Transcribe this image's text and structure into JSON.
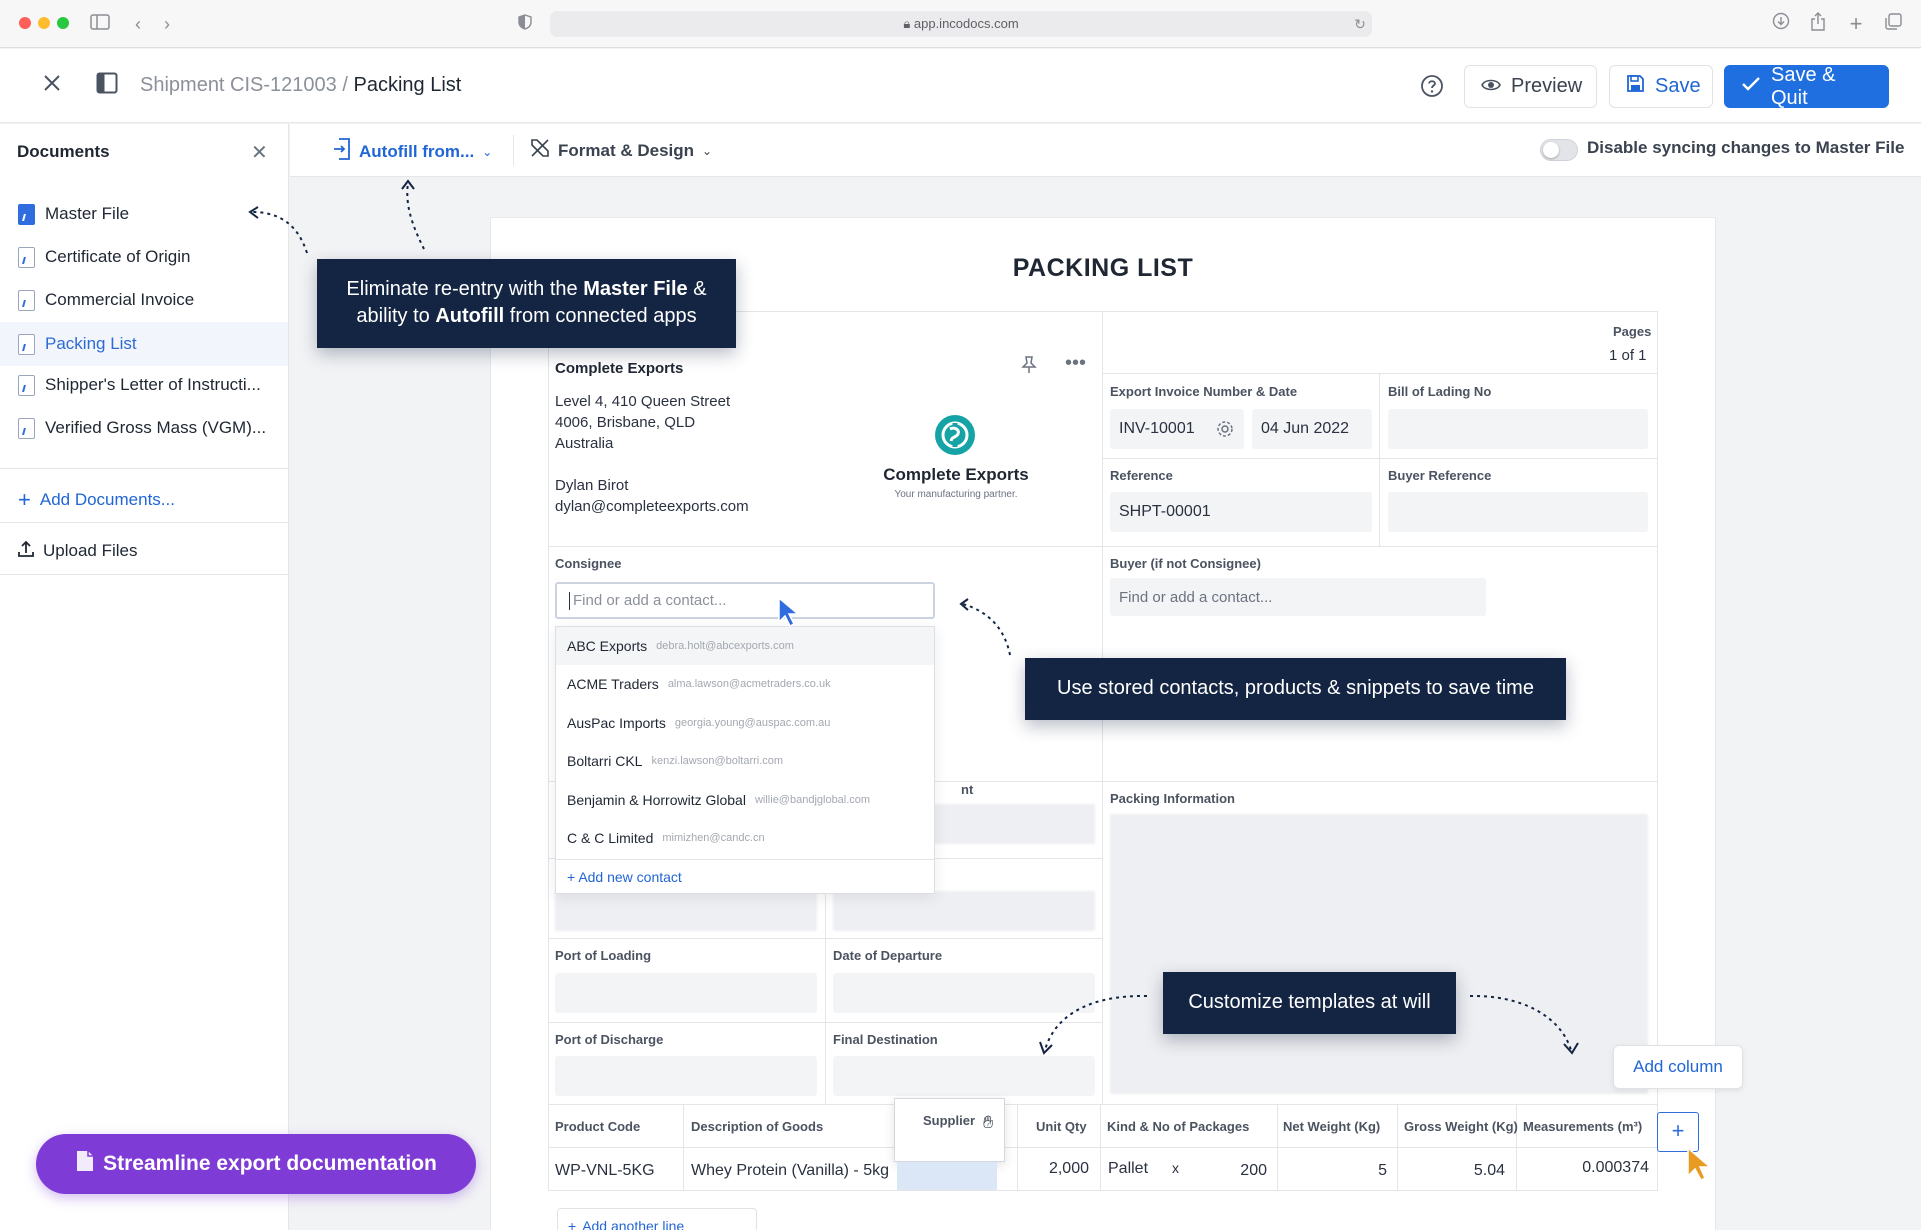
{
  "browser": {
    "url": "app.incodocs.com",
    "dot_colors": [
      "#fe5f57",
      "#febc2e",
      "#28c840"
    ]
  },
  "header": {
    "breadcrumb_parent": "Shipment CIS-121003",
    "breadcrumb_sep": "/",
    "breadcrumb_current": "Packing List",
    "preview_label": "Preview",
    "save_label": "Save",
    "save_quit_label": "Save & Quit"
  },
  "sidebar": {
    "title": "Documents",
    "items": [
      {
        "label": "Master File"
      },
      {
        "label": "Certificate of Origin"
      },
      {
        "label": "Commercial Invoice"
      },
      {
        "label": "Packing List"
      },
      {
        "label": "Shipper's Letter of Instructi..."
      },
      {
        "label": "Verified Gross Mass (VGM)..."
      }
    ],
    "add_documents": "Add Documents...",
    "upload_files": "Upload Files"
  },
  "toolbar": {
    "autofill_label": "Autofill from...",
    "format_label": "Format & Design",
    "sync_toggle_label": "Disable syncing changes to Master File"
  },
  "doc": {
    "title": "PACKING LIST",
    "pages_label": "Pages",
    "pages_value": "1 of 1",
    "exporter_name": "Complete Exports",
    "address_1": "Level 4, 410 Queen Street",
    "address_2": "4006, Brisbane, QLD",
    "address_3": "Australia",
    "contact_name": "Dylan Birot",
    "contact_email": "dylan@completeexports.com",
    "logo_name": "Complete Exports",
    "logo_tagline": "Your manufacturing partner.",
    "invoice_label": "Export Invoice Number & Date",
    "invoice_number": "INV-10001",
    "invoice_date": "04 Jun 2022",
    "bol_label": "Bill of Lading No",
    "reference_label": "Reference",
    "reference_value": "SHPT-00001",
    "buyer_ref_label": "Buyer Reference",
    "consignee_label": "Consignee",
    "consignee_placeholder": "Find or add a contact...",
    "buyer_label": "Buyer (if not Consignee)",
    "buyer_placeholder": "Find or add a contact...",
    "packing_info_label": "Packing Information",
    "port_loading_label": "Port of Loading",
    "date_departure_label": "Date of Departure",
    "port_discharge_label": "Port of Discharge",
    "final_destination_label": "Final Destination",
    "partial_label_fragment": "nt"
  },
  "contacts": [
    {
      "name": "ABC Exports",
      "email": "debra.holt@abcexports.com"
    },
    {
      "name": "ACME Traders",
      "email": "alma.lawson@acmetraders.co.uk"
    },
    {
      "name": "AusPac Imports",
      "email": "georgia.young@auspac.com.au"
    },
    {
      "name": "Boltarri CKL",
      "email": "kenzi.lawson@boltarri.com"
    },
    {
      "name": "Benjamin & Horrowitz Global",
      "email": "willie@bandjglobal.com"
    },
    {
      "name": "C & C Limited",
      "email": "mimizhen@candc.cn"
    }
  ],
  "add_new_contact": "Add new contact",
  "table": {
    "headers": [
      "Product Code",
      "Description of Goods",
      "Supplier",
      "Unit Qty",
      "Kind & No of Packages",
      "Net Weight (Kg)",
      "Gross Weight (Kg)",
      "Measurements (m³)"
    ],
    "row": {
      "product_code": "WP-VNL-5KG",
      "description": "Whey Protein (Vanilla) - 5kg",
      "unit_qty": "2,000",
      "package_kind": "Pallet",
      "times": "x",
      "package_count": "200",
      "net_weight": "5",
      "gross_weight": "5.04",
      "measurements": "0.000374"
    },
    "add_line": "Add another line",
    "add_column": "Add column"
  },
  "tooltips": {
    "master_file_pre": "Eliminate re-entry with the ",
    "master_file_bold": "Master File",
    "master_file_mid": " &",
    "master_file_line2_pre": "ability to ",
    "master_file_line2_bold": "Autofill",
    "master_file_line2_post": " from connected apps",
    "contacts": "Use stored contacts, products & snippets to save time",
    "templates": "Customize templates at will"
  },
  "promo": "Streamline export documentation",
  "colors": {
    "primary": "#1f6fe0",
    "tooltip_bg": "#132542",
    "promo_bg": "#7e3bd6",
    "logo_teal": "#15a3a6"
  }
}
